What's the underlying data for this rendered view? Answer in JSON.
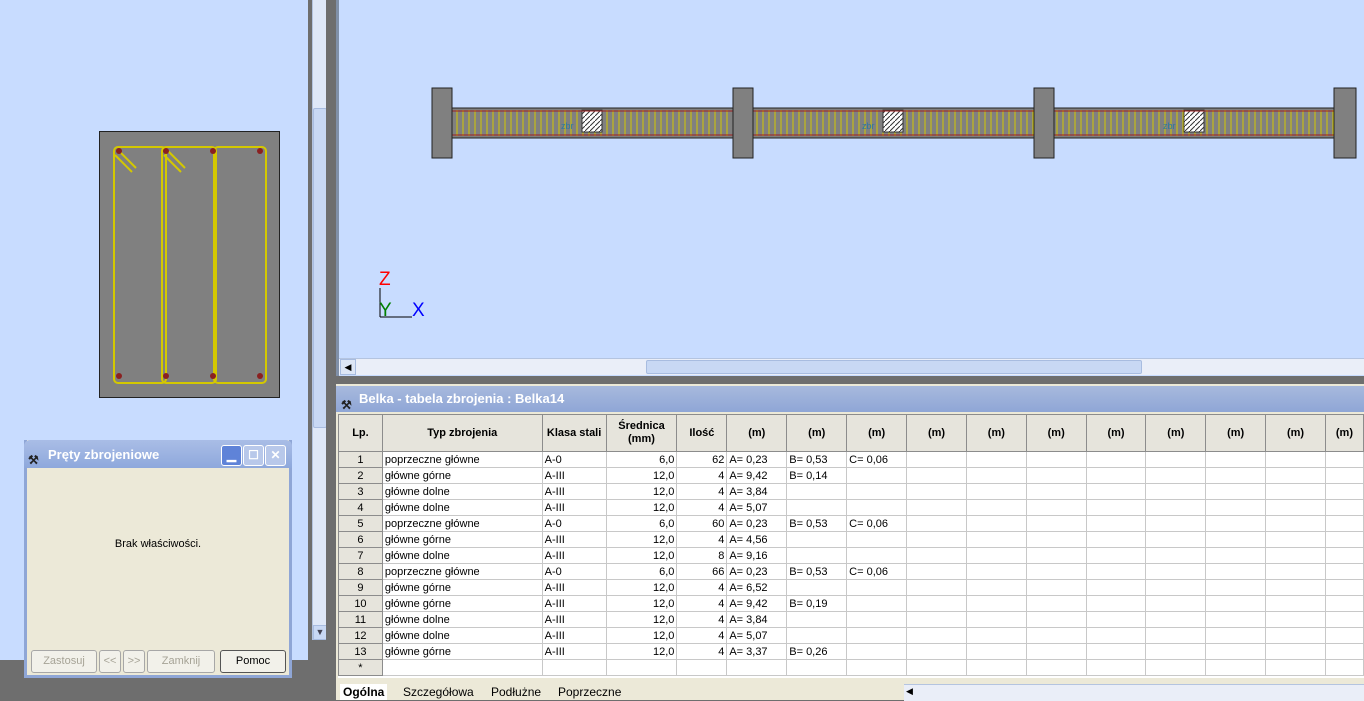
{
  "view": {
    "z_label": "Z",
    "y_label": "Y",
    "x_label": "X",
    "segment_labels": [
      "zbr",
      "zbr",
      "zbr"
    ]
  },
  "table_window": {
    "title": "Belka - tabela zbrojenia : Belka14",
    "columns": [
      "Lp.",
      "Typ zbrojenia",
      "Klasa stali",
      "Średnica (mm)",
      "Ilość",
      "(m)",
      "(m)",
      "(m)",
      "(m)",
      "(m)",
      "(m)",
      "(m)",
      "(m)",
      "(m)",
      "(m)",
      "(m)"
    ],
    "rows": [
      {
        "lp": "1",
        "typ": "poprzeczne główne",
        "klasa": "A-0",
        "srednica": "6,0",
        "ilosc": "62",
        "a": "A= 0,23",
        "b": "B= 0,53",
        "c": "C= 0,06"
      },
      {
        "lp": "2",
        "typ": "główne górne",
        "klasa": "A-III",
        "srednica": "12,0",
        "ilosc": "4",
        "a": "A= 9,42",
        "b": "B= 0,14",
        "c": ""
      },
      {
        "lp": "3",
        "typ": "główne dolne",
        "klasa": "A-III",
        "srednica": "12,0",
        "ilosc": "4",
        "a": "A= 3,84",
        "b": "",
        "c": ""
      },
      {
        "lp": "4",
        "typ": "główne dolne",
        "klasa": "A-III",
        "srednica": "12,0",
        "ilosc": "4",
        "a": "A= 5,07",
        "b": "",
        "c": ""
      },
      {
        "lp": "5",
        "typ": "poprzeczne główne",
        "klasa": "A-0",
        "srednica": "6,0",
        "ilosc": "60",
        "a": "A= 0,23",
        "b": "B= 0,53",
        "c": "C= 0,06"
      },
      {
        "lp": "6",
        "typ": "główne górne",
        "klasa": "A-III",
        "srednica": "12,0",
        "ilosc": "4",
        "a": "A= 4,56",
        "b": "",
        "c": ""
      },
      {
        "lp": "7",
        "typ": "główne dolne",
        "klasa": "A-III",
        "srednica": "12,0",
        "ilosc": "8",
        "a": "A= 9,16",
        "b": "",
        "c": ""
      },
      {
        "lp": "8",
        "typ": "poprzeczne główne",
        "klasa": "A-0",
        "srednica": "6,0",
        "ilosc": "66",
        "a": "A= 0,23",
        "b": "B= 0,53",
        "c": "C= 0,06"
      },
      {
        "lp": "9",
        "typ": "główne górne",
        "klasa": "A-III",
        "srednica": "12,0",
        "ilosc": "4",
        "a": "A= 6,52",
        "b": "",
        "c": ""
      },
      {
        "lp": "10",
        "typ": "główne górne",
        "klasa": "A-III",
        "srednica": "12,0",
        "ilosc": "4",
        "a": "A= 9,42",
        "b": "B= 0,19",
        "c": ""
      },
      {
        "lp": "11",
        "typ": "główne dolne",
        "klasa": "A-III",
        "srednica": "12,0",
        "ilosc": "4",
        "a": "A= 3,84",
        "b": "",
        "c": ""
      },
      {
        "lp": "12",
        "typ": "główne dolne",
        "klasa": "A-III",
        "srednica": "12,0",
        "ilosc": "4",
        "a": "A= 5,07",
        "b": "",
        "c": ""
      },
      {
        "lp": "13",
        "typ": "główne górne",
        "klasa": "A-III",
        "srednica": "12,0",
        "ilosc": "4",
        "a": "A= 3,37",
        "b": "B= 0,26",
        "c": ""
      }
    ],
    "new_row_marker": "*"
  },
  "tabs": [
    "Ogólna",
    "Szczegółowa",
    "Podłużne",
    "Poprzeczne"
  ],
  "dialog": {
    "title": "Pręty zbrojeniowe",
    "message": "Brak właściwości.",
    "buttons": {
      "apply": "Zastosuj",
      "prev": "<<",
      "next": ">>",
      "close": "Zamknij",
      "help": "Pomoc"
    }
  },
  "colors": {
    "background_blue": "#c8dcff",
    "rebar_yellow": "#d4c800",
    "concrete_gray": "#808080",
    "axis_z": "#ff0000",
    "axis_y": "#008000",
    "axis_x": "#0000ff"
  }
}
